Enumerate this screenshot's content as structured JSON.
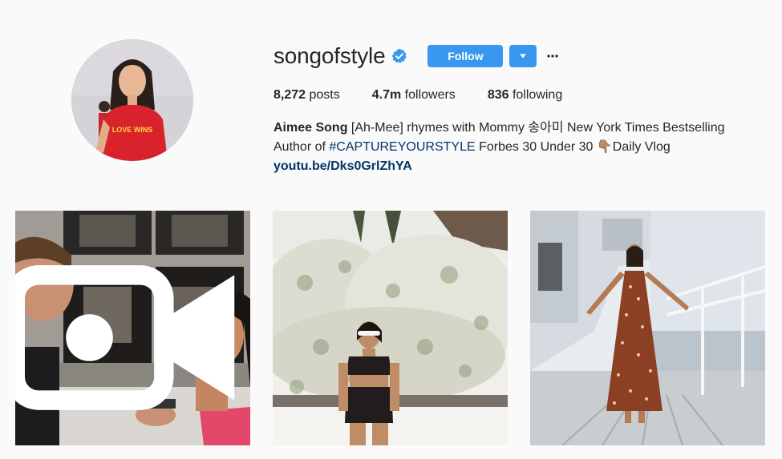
{
  "profile": {
    "username": "songofstyle",
    "verified_icon": "verified-badge-icon",
    "follow_label": "Follow",
    "dropdown_icon": "caret-down-icon",
    "more_icon": "more-options-icon"
  },
  "stats": {
    "posts_count": "8,272",
    "posts_label": "posts",
    "followers_count": "4.7m",
    "followers_label": "followers",
    "following_count": "836",
    "following_label": "following"
  },
  "bio": {
    "name": "Aimee Song",
    "line1_rest": " [Ah-Mee] rhymes with Mommy 송아미 New York Times Bestselling",
    "line2_prefix": "Author of ",
    "hashtag": "#CAPTUREYOURSTYLE",
    "line2_suffix": " Forbes 30 Under 30 👇🏽Daily Vlog",
    "link": "youtu.be/Dks0GrlZhYA"
  },
  "posts": [
    {
      "type": "video",
      "icon": "video-icon"
    },
    {
      "type": "photo"
    },
    {
      "type": "photo"
    }
  ],
  "avatar_shirt_text": "LOVE WINS",
  "colors": {
    "accent": "#3897f0",
    "verified": "#3897f0",
    "link": "#003569",
    "background": "#fafafa"
  }
}
